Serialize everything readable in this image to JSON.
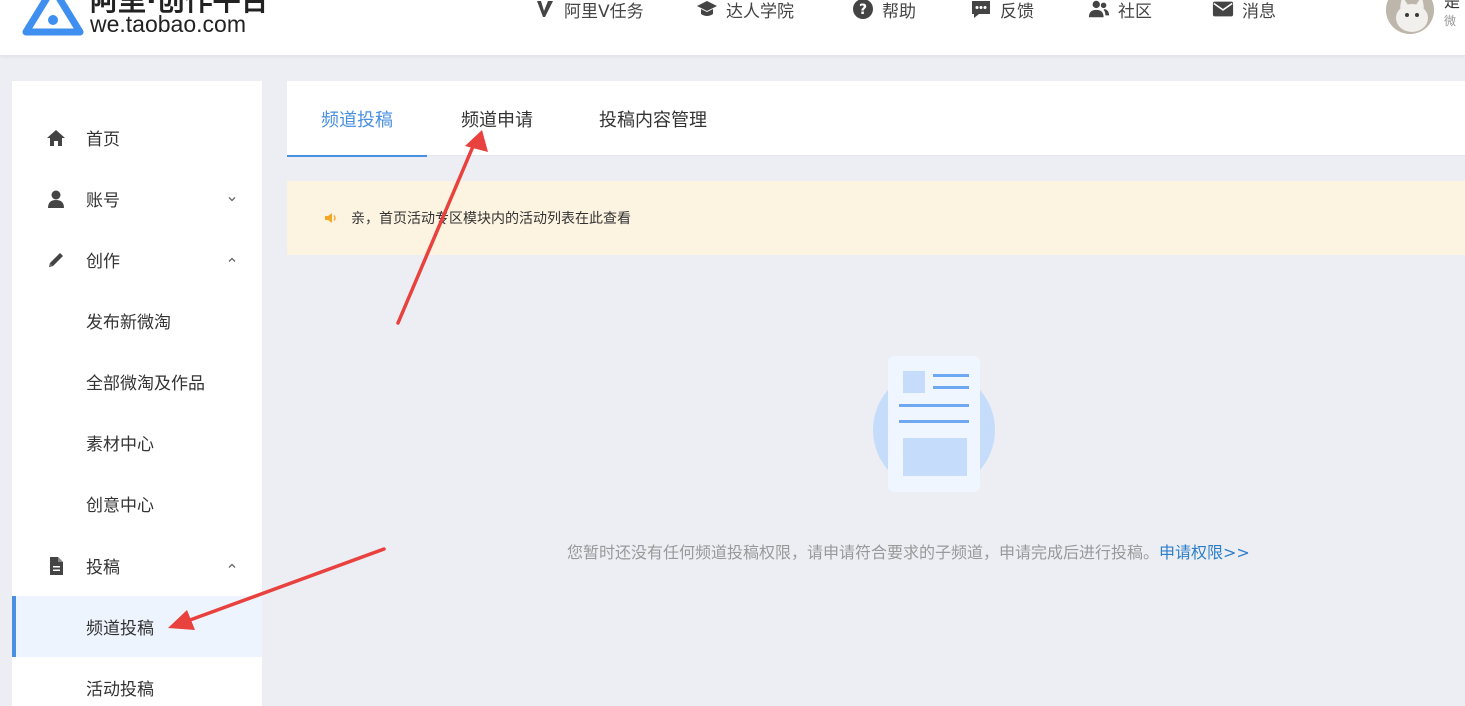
{
  "header": {
    "title": "阿里·创作平台",
    "domain": "we.taobao.com",
    "nav": [
      {
        "label": "阿里V任务",
        "icon": "v-icon"
      },
      {
        "label": "达人学院",
        "icon": "graduation-cap-icon"
      },
      {
        "label": "帮助",
        "icon": "question-icon"
      },
      {
        "label": "反馈",
        "icon": "chat-bubble-icon"
      },
      {
        "label": "社区",
        "icon": "users-icon"
      },
      {
        "label": "消息",
        "icon": "mail-icon"
      }
    ],
    "user": {
      "name": "是",
      "sub": "微"
    }
  },
  "sidebar": {
    "items": [
      {
        "label": "首页",
        "icon": "home-icon"
      },
      {
        "label": "账号",
        "icon": "user-icon"
      },
      {
        "label": "创作",
        "icon": "pencil-icon"
      },
      {
        "label": "发布新微淘"
      },
      {
        "label": "全部微淘及作品"
      },
      {
        "label": "素材中心"
      },
      {
        "label": "创意中心"
      },
      {
        "label": "投稿",
        "icon": "document-icon"
      },
      {
        "label": "频道投稿"
      },
      {
        "label": "活动投稿"
      }
    ]
  },
  "tabs": [
    {
      "label": "频道投稿"
    },
    {
      "label": "频道申请"
    },
    {
      "label": "投稿内容管理"
    }
  ],
  "notice": {
    "text": "亲，首页活动专区模块内的活动列表在此查看"
  },
  "empty": {
    "text": "您暂时还没有任何频道投稿权限，请申请符合要求的子频道，申请完成后进行投稿。",
    "link": "申请权限>>"
  },
  "colors": {
    "accent": "#4a90e2",
    "arrow": "#e8413e",
    "notice_bg": "#fdf3e1",
    "link": "#2d7fc8"
  }
}
